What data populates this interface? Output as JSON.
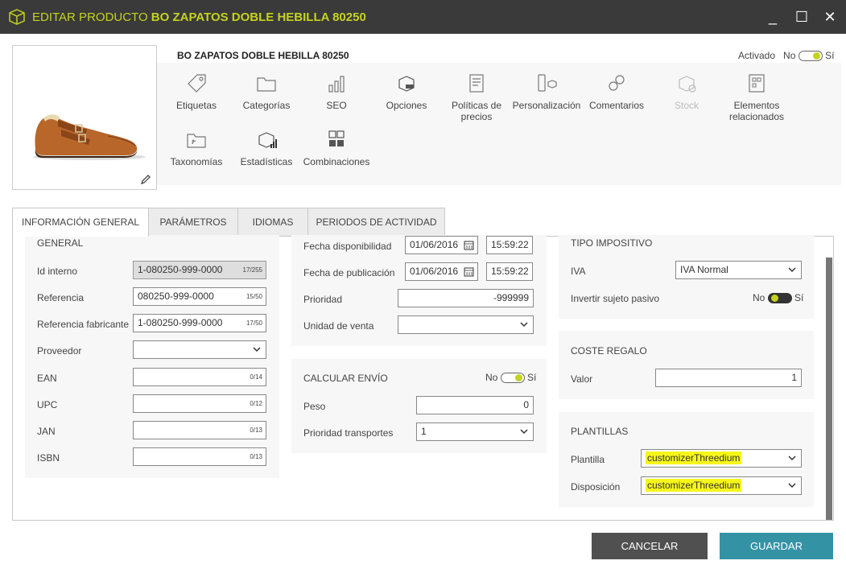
{
  "window": {
    "title_prefix": "EDITAR PRODUCTO",
    "title_product": "BO ZAPATOS DOBLE HEBILLA 80250",
    "minimize": "_",
    "maximize": "☐",
    "close": "✕"
  },
  "product": {
    "name": "BO ZAPATOS DOBLE HEBILLA 80250",
    "activado_label": "Activado",
    "activado_no": "No",
    "activado_si": "Sí",
    "activado": true
  },
  "toolbar": [
    {
      "label": "Etiquetas",
      "icon": "tag-icon"
    },
    {
      "label": "Categorías",
      "icon": "folder-icon"
    },
    {
      "label": "SEO",
      "icon": "seo-chart-icon"
    },
    {
      "label": "Opciones",
      "icon": "options-box-icon"
    },
    {
      "label": "Políticas de precios",
      "icon": "price-policy-icon"
    },
    {
      "label": "Personalización",
      "icon": "personalization-icon"
    },
    {
      "label": "Comentarios",
      "icon": "comments-icon"
    },
    {
      "label": "Stock",
      "icon": "stock-icon",
      "disabled": true
    },
    {
      "label": "Elementos relacionados",
      "icon": "related-items-icon"
    },
    {
      "label": "Taxonomías",
      "icon": "taxonomy-folder-icon"
    },
    {
      "label": "Estadísticas",
      "icon": "statistics-box-icon"
    },
    {
      "label": "Combinaciones",
      "icon": "combinations-icon"
    }
  ],
  "tabs": [
    {
      "label": "INFORMACIÓN GENERAL",
      "active": true
    },
    {
      "label": "PARÁMETROS"
    },
    {
      "label": "IDIOMAS"
    },
    {
      "label": "PERIODOS DE ACTIVIDAD"
    }
  ],
  "general": {
    "title": "GENERAL",
    "id_interno": {
      "label": "Id interno",
      "value": "1-080250-999-0000",
      "count": "17/255"
    },
    "referencia": {
      "label": "Referencia",
      "value": "080250-999-0000",
      "count": "15/50"
    },
    "ref_fabricante": {
      "label": "Referencia fabricante",
      "value": "1-080250-999-0000",
      "count": "17/50"
    },
    "proveedor": {
      "label": "Proveedor",
      "value": ""
    },
    "ean": {
      "label": "EAN",
      "value": "",
      "count": "0/14"
    },
    "upc": {
      "label": "UPC",
      "value": "",
      "count": "0/12"
    },
    "jan": {
      "label": "JAN",
      "value": "",
      "count": "0/13"
    },
    "isbn": {
      "label": "ISBN",
      "value": "",
      "count": "0/13"
    }
  },
  "fechas": {
    "disponibilidad": {
      "label": "Fecha disponibilidad",
      "date": "01/06/2016",
      "time": "15:59:22"
    },
    "publicacion": {
      "label": "Fecha de publicación",
      "date": "01/06/2016",
      "time": "15:59:22"
    },
    "prioridad": {
      "label": "Prioridad",
      "value": "-999999"
    },
    "unidad_venta": {
      "label": "Unidad de venta",
      "value": ""
    }
  },
  "envio": {
    "title": "CALCULAR ENVÍO",
    "no": "No",
    "si": "Sí",
    "enabled": true,
    "peso": {
      "label": "Peso",
      "value": "0"
    },
    "prioridad_transportes": {
      "label": "Prioridad transportes",
      "value": "1"
    }
  },
  "impositivo": {
    "title": "TIPO IMPOSITIVO",
    "iva": {
      "label": "IVA",
      "value": "IVA Normal"
    },
    "invertir": {
      "label": "Invertir sujeto pasivo",
      "no": "No",
      "si": "Sí",
      "enabled": true
    }
  },
  "regalo": {
    "title": "COSTE REGALO",
    "valor": {
      "label": "Valor",
      "value": "1"
    }
  },
  "plantillas": {
    "title": "PLANTILLAS",
    "plantilla": {
      "label": "Plantilla",
      "value": "customizerThreedium"
    },
    "disposicion": {
      "label": "Disposición",
      "value": "customizerThreedium"
    }
  },
  "footer": {
    "cancel": "CANCELAR",
    "save": "GUARDAR"
  },
  "colors": {
    "titlebar_bg": "#3a3a3a",
    "accent": "#c5d21f",
    "cancel_bg": "#505050",
    "save_bg": "#3393a5",
    "highlight": "#f6f61a"
  }
}
